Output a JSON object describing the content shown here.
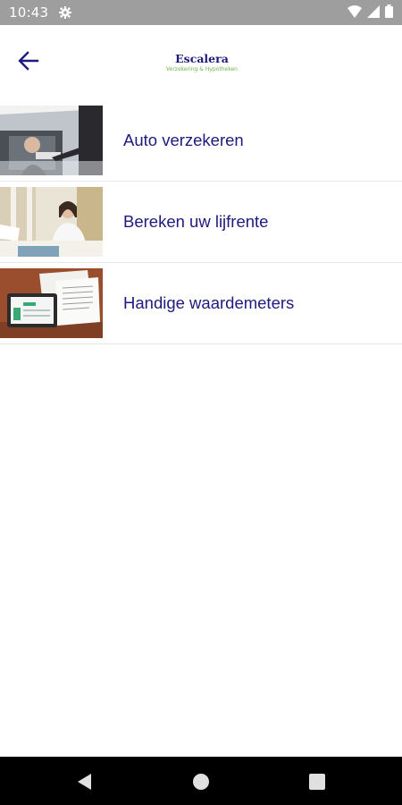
{
  "status_bar": {
    "time": "10:43",
    "icons": [
      "gear-icon",
      "wifi-icon",
      "signal-icon",
      "battery-icon"
    ]
  },
  "app_bar": {
    "back_icon": "arrow-left-icon",
    "logo": {
      "title": "Escalera",
      "subtitle": "Verzekering & Hypotheken"
    }
  },
  "menu": {
    "items": [
      {
        "label": "Auto verzekeren",
        "image": "man-in-car-photo"
      },
      {
        "label": "Bereken uw lijfrente",
        "image": "woman-at-desk-photo"
      },
      {
        "label": "Handige waardemeters",
        "image": "tablet-and-documents-photo"
      }
    ]
  },
  "nav_bar": {
    "buttons": [
      "back-triangle-icon",
      "home-circle-icon",
      "recents-square-icon"
    ]
  },
  "colors": {
    "accent": "#1f1a7e",
    "logo_green": "#6fb34a",
    "status_bar": "#9e9e9e",
    "nav_bar": "#000000"
  }
}
